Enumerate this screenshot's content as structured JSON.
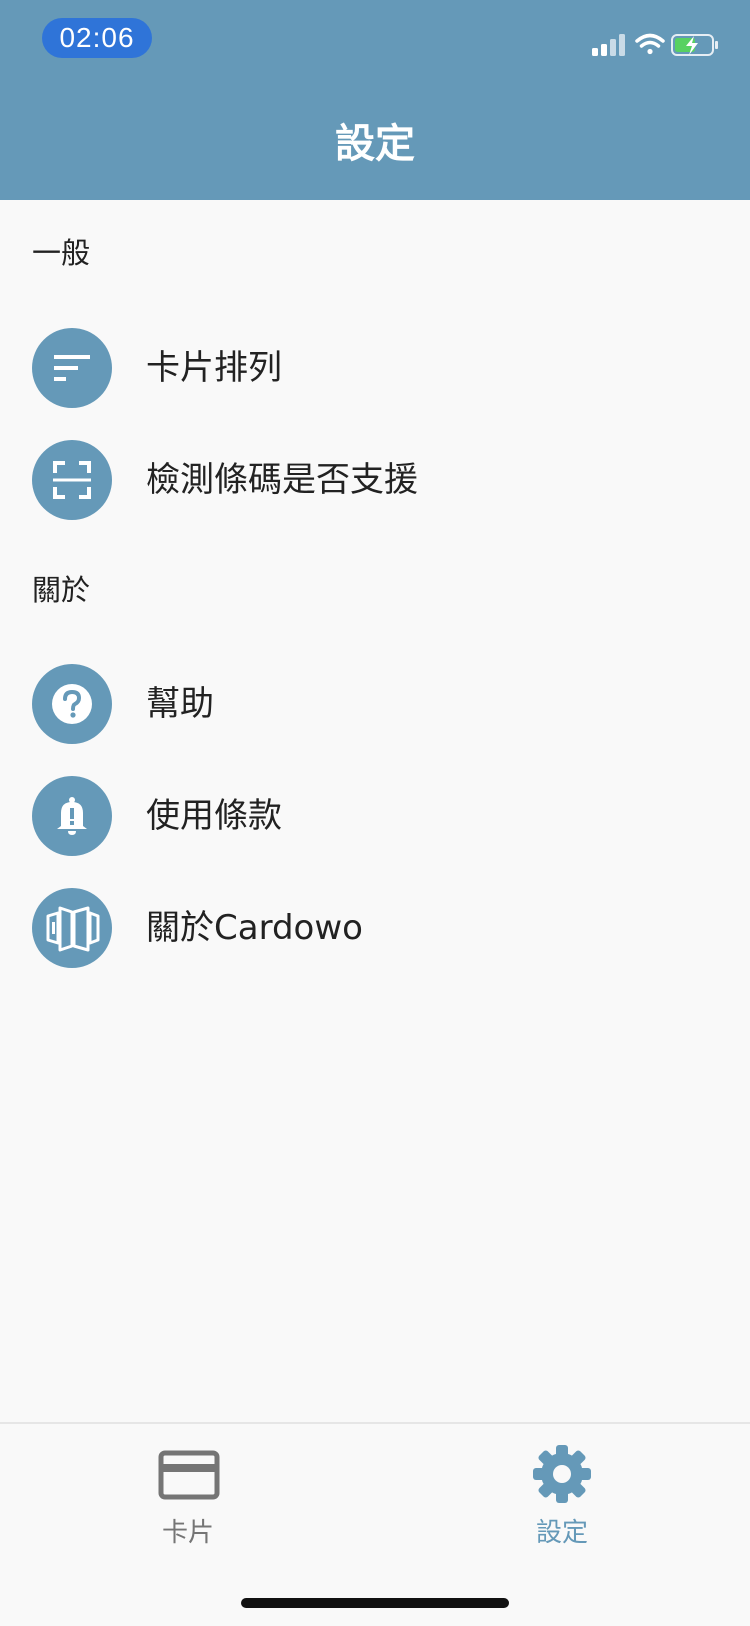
{
  "status_bar": {
    "time": "02:06"
  },
  "header": {
    "title": "設定"
  },
  "sections": {
    "general": {
      "title": "一般",
      "items": [
        {
          "label": "卡片排列",
          "icon": "sort-icon"
        },
        {
          "label": "檢測條碼是否支援",
          "icon": "scan-icon"
        }
      ]
    },
    "about": {
      "title": "關於",
      "items": [
        {
          "label": "幫助",
          "icon": "help-icon"
        },
        {
          "label": "使用條款",
          "icon": "bell-alert-icon"
        },
        {
          "label": "關於Cardowo",
          "icon": "cardowo-logo-icon"
        }
      ]
    }
  },
  "tab_bar": {
    "tabs": [
      {
        "label": "卡片",
        "icon": "credit-card-icon",
        "active": false
      },
      {
        "label": "設定",
        "icon": "gear-icon",
        "active": true
      }
    ]
  },
  "colors": {
    "accent": "#6599b8",
    "time_pill": "#2f74d8",
    "inactive_tab": "#757575"
  }
}
